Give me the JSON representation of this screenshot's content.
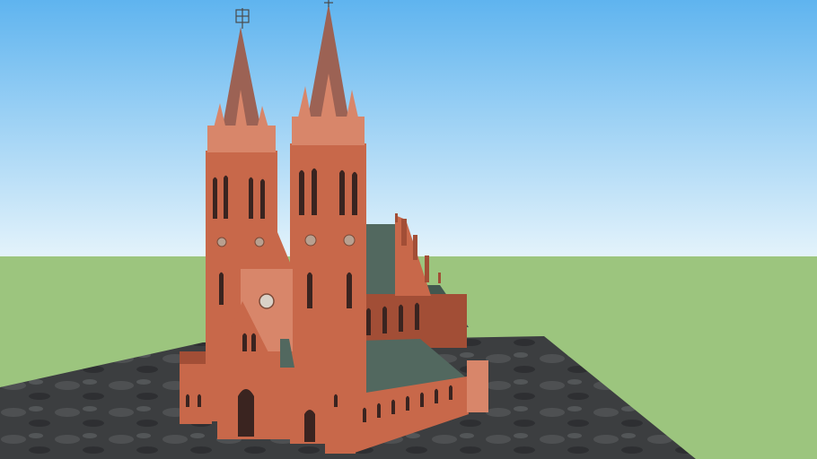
{
  "scene": {
    "kind": "3d-model-viewport",
    "subject": "brick-gothic-cathedral-model",
    "colors": {
      "sky_top": "#5fb4ef",
      "sky_bottom": "#e4f3fb",
      "ground": "#9cc57e",
      "terrain": "#3c3e40",
      "brick": "#c8684a",
      "brick_dark": "#a24e36",
      "brick_light": "#d8866a",
      "spire": "#9c6254",
      "roof": "#52685f",
      "roof_dark": "#43574f",
      "window": "#3a2420"
    }
  }
}
